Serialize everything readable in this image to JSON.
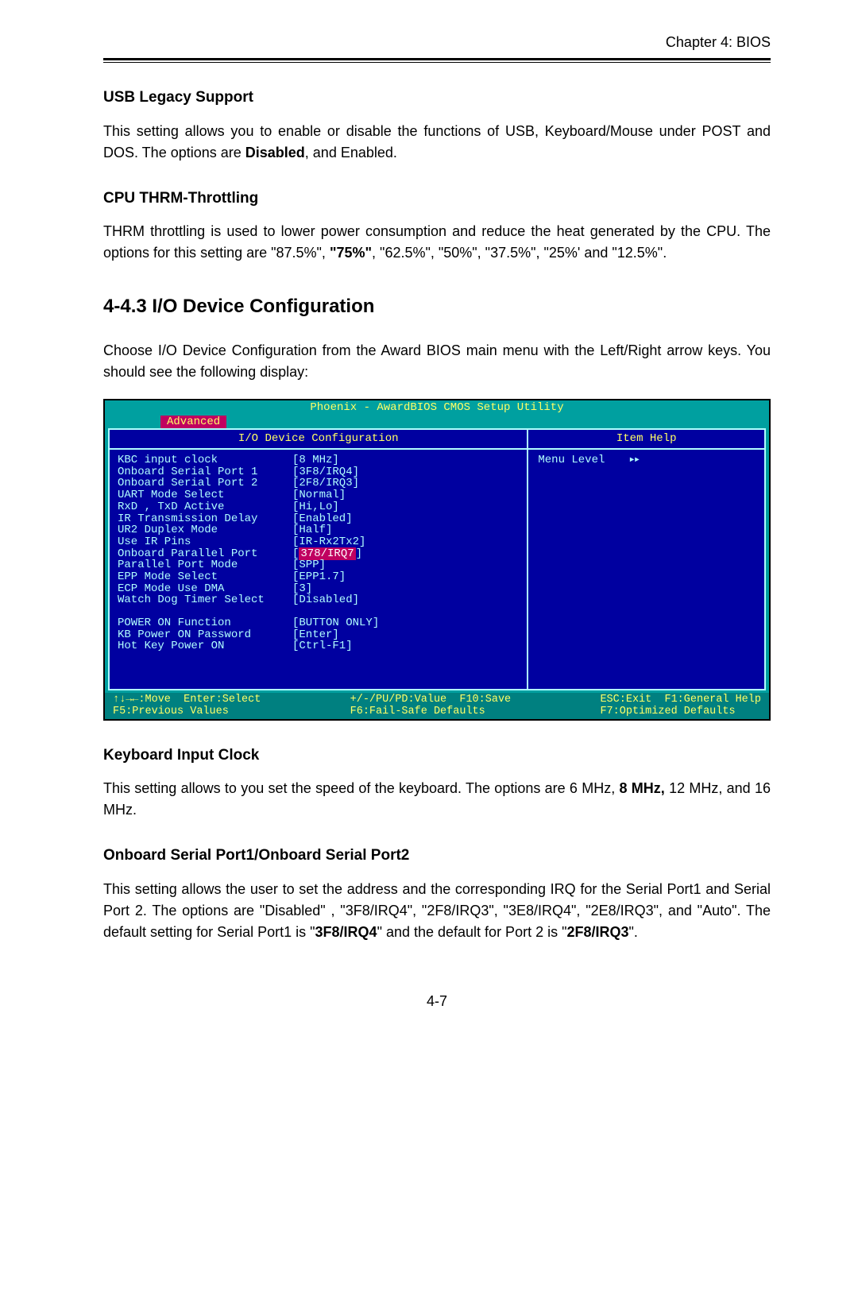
{
  "page": {
    "chapter": "Chapter 4: BIOS",
    "page_number": "4-7"
  },
  "sections": {
    "usb_legacy": {
      "title": "USB Legacy Support",
      "text_a": "This setting allows you to enable or disable the functions of USB, Keyboard/Mouse under POST and DOS. The options are ",
      "bold_a": "Disabled",
      "text_b": ", and Enabled."
    },
    "cpu_thrm": {
      "title": "CPU THRM-Throttling",
      "text_a": "THRM throttling is used to lower power consumption and reduce the heat generated by the CPU.  The options for this setting are \"87.5%\", ",
      "bold_a": "\"75%\"",
      "text_b": ", \"62.5%\", \"50%\", \"37.5%\", \"25%' and \"12.5%\"."
    },
    "iodev": {
      "title": "4-4.3  I/O Device Configuration",
      "text": "Choose I/O Device Configuration from the Award BIOS main menu with the Left/Right arrow keys.  You should see the following display:"
    },
    "kbd_clock": {
      "title": "Keyboard Input Clock",
      "text_a": "This setting allows to you set the speed of the keyboard. The options are 6 MHz, ",
      "bold_a": "8 MHz,",
      "text_b": "  12 MHz, and 16 MHz."
    },
    "serial": {
      "title": "Onboard Serial Port1/Onboard Serial Port2",
      "text_a": "This setting allows the user to set  the address and the corresponding IRQ for  the Serial Port1 and Serial Port 2.   The options are \"Disabled\" , \"3F8/IRQ4\", \"2F8/IRQ3\", \"3E8/IRQ4\", \"2E8/IRQ3\", and \"Auto\".  The default setting for Serial Port1 is \"",
      "bold_a": "3F8/IRQ4",
      "text_b": "\" and the default for Port 2 is \"",
      "bold_b": "2F8/IRQ3",
      "text_c": "\"."
    }
  },
  "bios": {
    "title": "Phoenix - AwardBIOS CMOS Setup Utility",
    "tab": "Advanced",
    "left_head": "I/O Device Configuration",
    "right_head": "Item Help",
    "menu_level": "Menu Level",
    "settings": [
      {
        "label": "KBC input clock",
        "value": "[8 MHz]"
      },
      {
        "label": "Onboard Serial Port 1",
        "value": "[3F8/IRQ4]"
      },
      {
        "label": "Onboard Serial Port 2",
        "value": "[2F8/IRQ3]"
      },
      {
        "label": "UART Mode Select",
        "value": "[Normal]"
      },
      {
        "label": "RxD , TxD Active",
        "value": "[Hi,Lo]"
      },
      {
        "label": "IR Transmission Delay",
        "value": "[Enabled]"
      },
      {
        "label": "UR2 Duplex Mode",
        "value": "[Half]"
      },
      {
        "label": "Use IR Pins",
        "value": "[IR-Rx2Tx2]"
      },
      {
        "label": "Onboard Parallel Port",
        "value": "[378/IRQ7]",
        "selected": true
      },
      {
        "label": "Parallel Port Mode",
        "value": "[SPP]"
      },
      {
        "label": "EPP Mode Select",
        "value": "[EPP1.7]"
      },
      {
        "label": "ECP Mode Use DMA",
        "value": "[3]"
      },
      {
        "label": "Watch Dog Timer Select",
        "value": "[Disabled]"
      }
    ],
    "settings2": [
      {
        "label": "POWER ON Function",
        "value": "[BUTTON ONLY]"
      },
      {
        "label": "KB Power ON Password",
        "value": "[Enter]"
      },
      {
        "label": "Hot Key Power ON",
        "value": "[Ctrl-F1]"
      }
    ],
    "footer": {
      "c1a": "↑↓→←:Move  Enter:Select",
      "c1b": "F5:Previous Values",
      "c2a": "+/-/PU/PD:Value  F10:Save",
      "c2b": "F6:Fail-Safe Defaults",
      "c3a": "ESC:Exit  F1:General Help",
      "c3b": "F7:Optimized Defaults"
    }
  }
}
